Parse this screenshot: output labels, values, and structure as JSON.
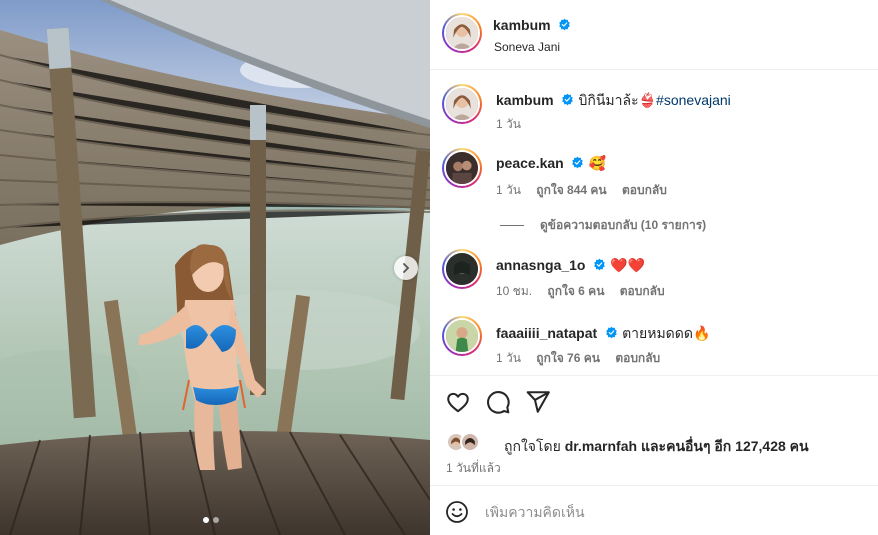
{
  "header": {
    "username": "kambum",
    "location": "Soneva Jani"
  },
  "caption": {
    "username": "kambum",
    "text": "บิกินีมาล้ะ👙",
    "hashtag": "#sonevajani",
    "time": "1 วัน"
  },
  "comments": [
    {
      "username": "peace.kan",
      "verified": true,
      "text": "🥰",
      "time": "1 วัน",
      "likes": "ถูกใจ 844 คน",
      "reply": "ตอบกลับ"
    },
    {
      "username": "annasnga_1o",
      "verified": true,
      "text": "❤️❤️",
      "time": "10 ชม.",
      "likes": "ถูกใจ 6 คน",
      "reply": "ตอบกลับ"
    },
    {
      "username": "faaaiiii_natapat",
      "verified": true,
      "text": "ตายหมดดด🔥",
      "time": "1 วัน",
      "likes": "ถูกใจ 76 คน",
      "reply": "ตอบกลับ"
    }
  ],
  "view_replies": "ดูข้อความตอบกลับ (10 รายการ)",
  "likes_summary": {
    "prefix": "ถูกใจโดย",
    "user": "dr.marnfah",
    "and_others": "และคนอื่นๆ อีก 127,428 คน"
  },
  "posted": "1 วันที่แล้ว",
  "comment_box": {
    "placeholder": "เพิ่มความคิดเห็น"
  },
  "carousel": {
    "current": 1,
    "total": 2
  },
  "colors": {
    "verified_blue": "#0095f6",
    "hashtag": "#00376b",
    "meta_gray": "#737373",
    "heart_red": "#e0102c"
  },
  "icons": [
    "verified-badge-icon",
    "heart-icon",
    "comment-icon",
    "share-icon",
    "emoji-icon",
    "chevron-right-icon"
  ]
}
